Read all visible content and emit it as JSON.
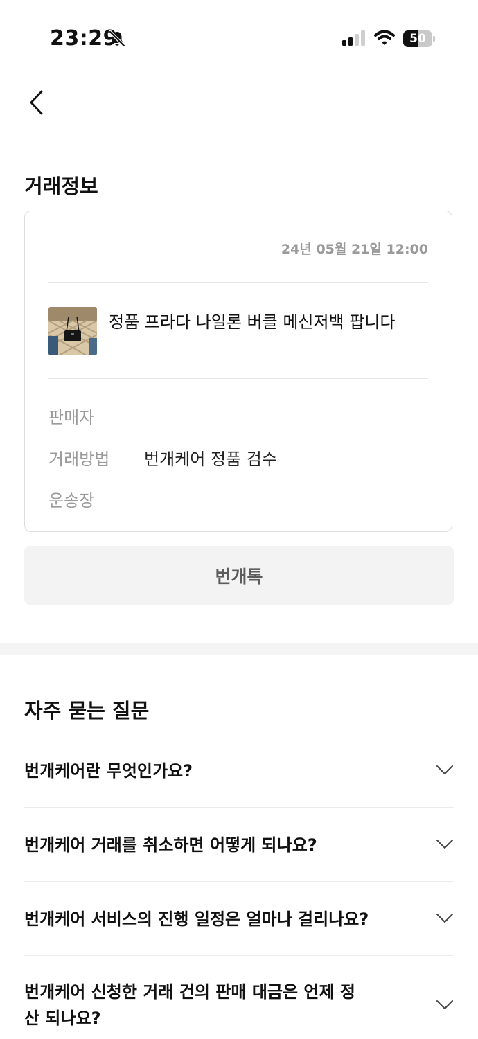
{
  "status_bar": {
    "time": "23:29",
    "battery_level": "50",
    "battery_fraction": 0.5,
    "icons": [
      "bell-slash-icon",
      "cellular-signal-icon",
      "wifi-icon",
      "battery-icon"
    ]
  },
  "header": {
    "back_icon": "chevron-left-icon"
  },
  "trade_info": {
    "section_title": "거래정보",
    "date": "24년 05월 21일 12:00",
    "product": {
      "title": "정품 프라다 나일론 버클 메신저백 팝니다",
      "thumbnail": "product-thumbnail"
    },
    "rows": [
      {
        "label": "판매자",
        "value": ""
      },
      {
        "label": "거래방법",
        "value": "번개케어 정품 검수"
      },
      {
        "label": "운송장",
        "value": ""
      }
    ]
  },
  "chat_button": {
    "label": "번개톡"
  },
  "faq": {
    "section_title": "자주 묻는 질문",
    "items": [
      {
        "question": "번개케어란 무엇인가요?"
      },
      {
        "question": "번개케어 거래를 취소하면 어떻게 되나요?"
      },
      {
        "question": "번개케어 서비스의 진행 일정은 얼마나 걸리나요?"
      },
      {
        "question": "번개케어 신청한 거래 건의 판매 대금은 언제 정산 되나요?"
      }
    ],
    "expand_icon": "chevron-down-icon"
  },
  "colors": {
    "text_primary": "#111111",
    "text_muted": "#9a9a9a",
    "card_border": "#dddddd",
    "button_bg": "#f3f3f3",
    "button_text": "#5c5c5c",
    "section_gap": "#f4f4f4"
  }
}
